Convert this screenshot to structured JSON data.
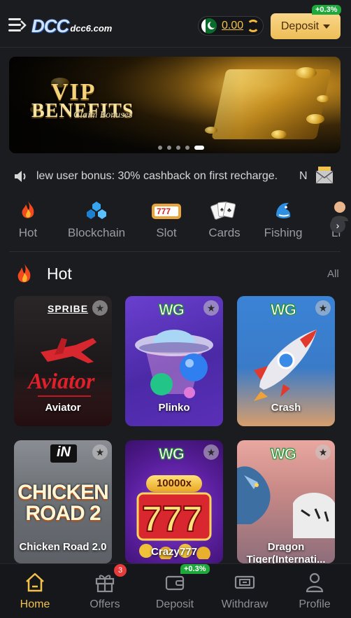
{
  "header": {
    "logo_main": "DCC",
    "logo_sub": "dcc6.com",
    "balance": "0.00",
    "deposit_label": "Deposit",
    "deposit_bonus": "+0.3%"
  },
  "banner": {
    "title": "VIP",
    "subtitle": "BENEFITS",
    "tagline": "Claim Bonuses",
    "slide_count": 5,
    "active_slide": 5
  },
  "marquee": {
    "text": "lew user bonus: 30% cashback on first recharge.",
    "trailing": "N"
  },
  "categories": [
    {
      "label": "Hot",
      "icon": "flame-icon"
    },
    {
      "label": "Blockchain",
      "icon": "blockchain-icon"
    },
    {
      "label": "Slot",
      "icon": "slot-machine-icon"
    },
    {
      "label": "Cards",
      "icon": "playing-cards-icon"
    },
    {
      "label": "Fishing",
      "icon": "shark-icon"
    },
    {
      "label": "Li",
      "icon": "live-dealer-icon"
    }
  ],
  "section": {
    "title": "Hot",
    "all_label": "All"
  },
  "games": [
    {
      "name": "Aviator",
      "provider": "SPRIBE"
    },
    {
      "name": "Plinko",
      "provider": "WG"
    },
    {
      "name": "Crash",
      "provider": "WG"
    },
    {
      "name": "Chicken Road 2.0",
      "provider": "iN",
      "art_title": "CHICKEN ROAD 2"
    },
    {
      "name": "Crazy777",
      "provider": "WG",
      "art_title": "10000x"
    },
    {
      "name": "Dragon Tiger(Internati...",
      "provider": "WG"
    }
  ],
  "bottom_nav": [
    {
      "label": "Home",
      "icon": "home-icon",
      "active": true
    },
    {
      "label": "Offers",
      "icon": "gift-icon",
      "badge": "3"
    },
    {
      "label": "Deposit",
      "icon": "wallet-icon",
      "badge": "+0.3%"
    },
    {
      "label": "Withdraw",
      "icon": "withdraw-icon"
    },
    {
      "label": "Profile",
      "icon": "profile-icon"
    }
  ]
}
